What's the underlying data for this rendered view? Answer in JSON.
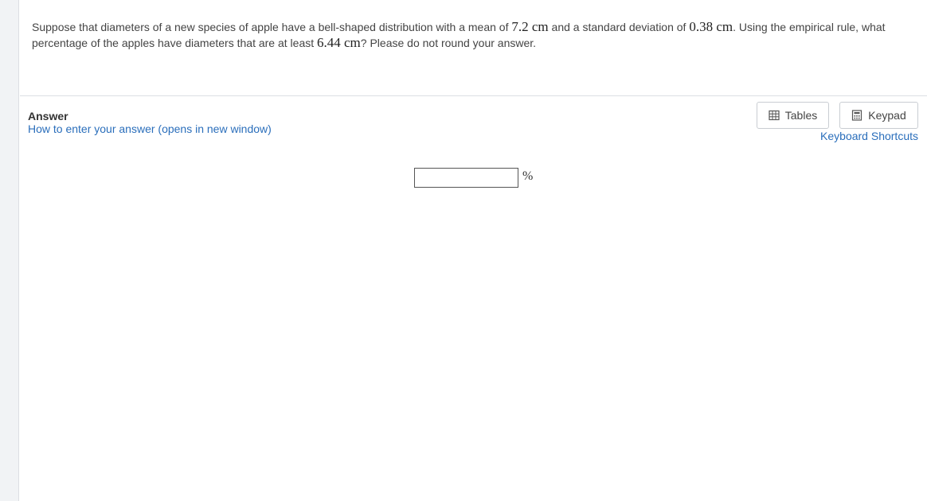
{
  "question": {
    "t1": "Suppose that diameters of a new species of apple have a bell-shaped distribution with a mean of ",
    "m1": "7.2 cm",
    "t2": " and a standard deviation of ",
    "m2": "0.38 cm",
    "t3": ".  Using the empirical rule, what percentage of the apples have diameters that are at least ",
    "m3": "6.44 cm",
    "t4": "?  Please do not round your answer."
  },
  "answer": {
    "label": "Answer",
    "help_link": "How to enter your answer (opens in new window)",
    "input_value": "",
    "unit": "%"
  },
  "tools": {
    "tables_label": "Tables",
    "keypad_label": "Keypad",
    "shortcuts_label": "Keyboard Shortcuts"
  }
}
